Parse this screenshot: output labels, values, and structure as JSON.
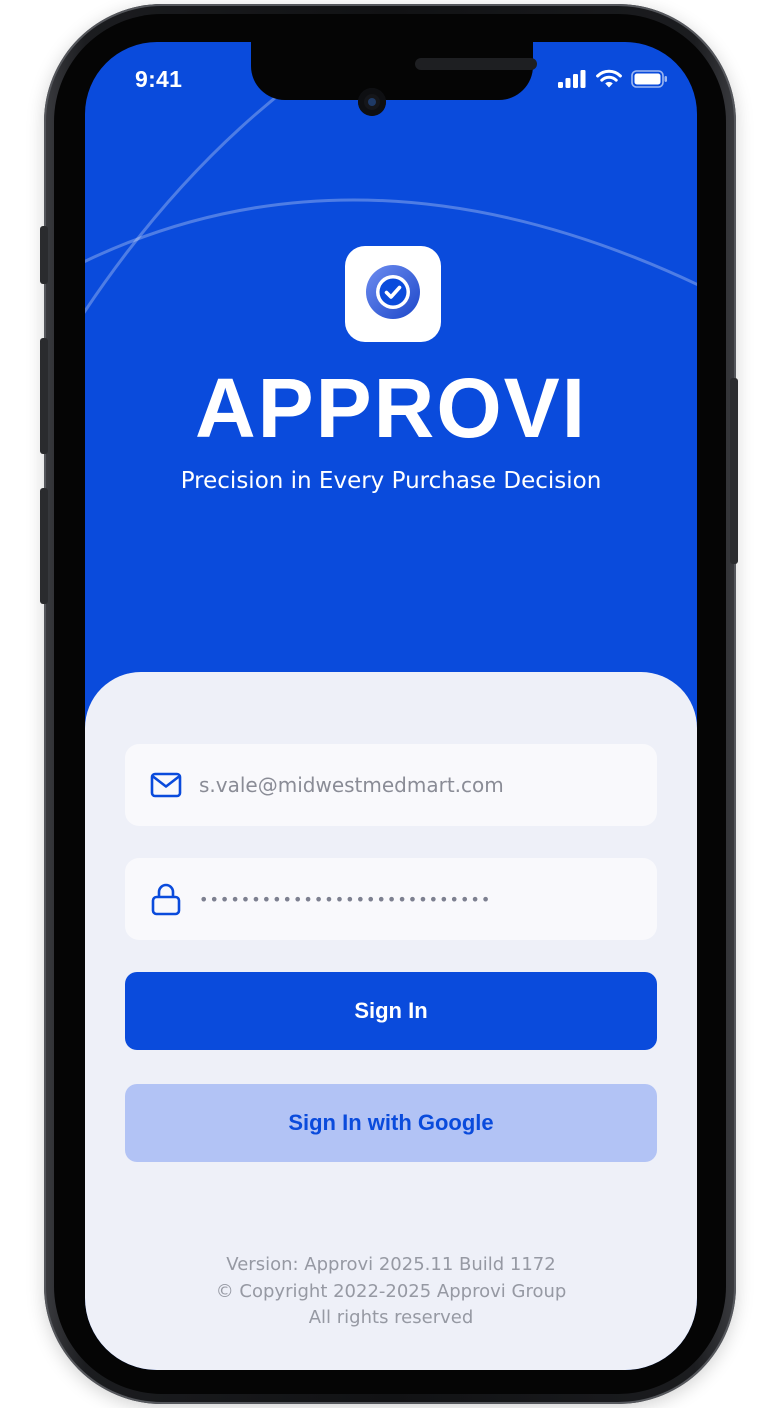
{
  "status_bar": {
    "time": "9:41",
    "icons": [
      "signal-icon",
      "wifi-icon",
      "battery-icon"
    ]
  },
  "brand": {
    "logo_icon": "check-circle-icon",
    "name": "APPROVI",
    "tagline": "Precision in Every Purchase Decision"
  },
  "login": {
    "email_value": "s.vale@midwestmedmart.com",
    "email_icon": "mail-icon",
    "password_value": "••••••••••••••••••••••••••••",
    "password_icon": "lock-icon",
    "sign_in_label": "Sign In",
    "google_label": "Sign In with Google"
  },
  "footer": {
    "version": "Version: Approvi 2025.11 Build 1172",
    "copyright": "© Copyright 2022-2025 Approvi Group",
    "rights": "All rights reserved"
  },
  "colors": {
    "primary": "#0a4bdc",
    "card_background": "#eef0f8",
    "secondary_button": "#b2c3f5",
    "muted_text": "#9699a3"
  }
}
